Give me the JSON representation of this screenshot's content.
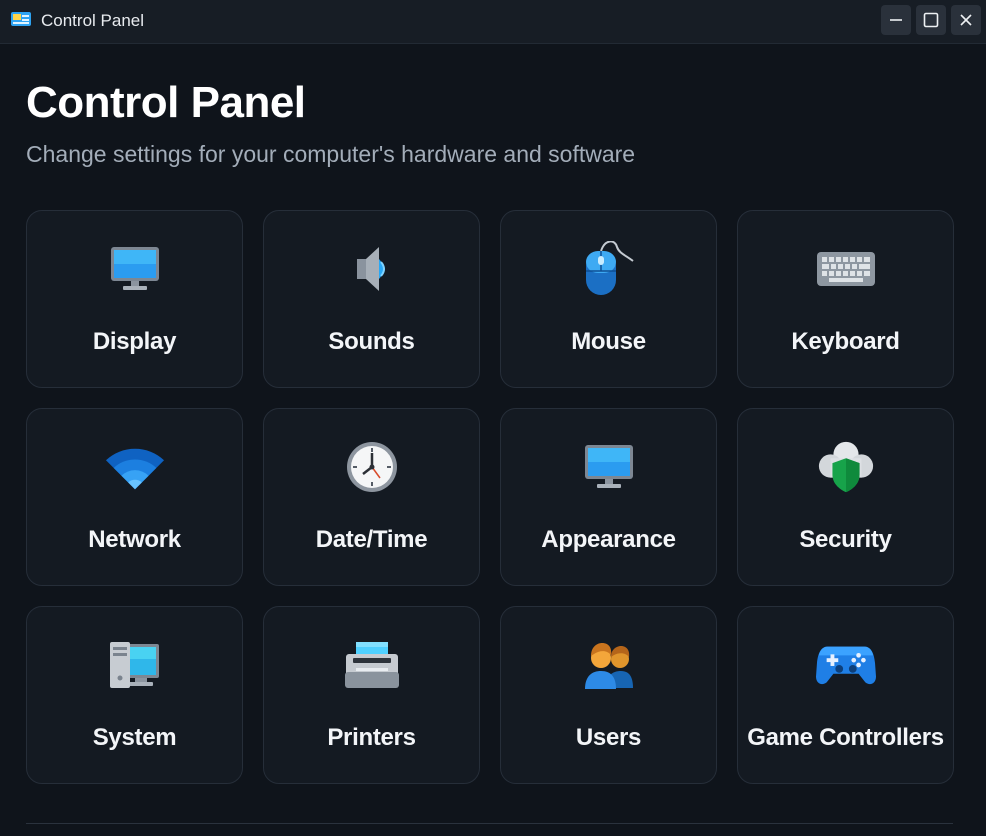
{
  "window": {
    "title": "Control Panel",
    "controls": {
      "minimize": "minimize-icon",
      "maximize": "maximize-icon",
      "close": "close-icon"
    }
  },
  "header": {
    "title": "Control Panel",
    "subtitle": "Change settings for your computer's hardware and software"
  },
  "tiles": [
    {
      "label": "Display",
      "icon": "monitor-icon"
    },
    {
      "label": "Sounds",
      "icon": "speaker-icon"
    },
    {
      "label": "Mouse",
      "icon": "mouse-icon"
    },
    {
      "label": "Keyboard",
      "icon": "keyboard-icon"
    },
    {
      "label": "Network",
      "icon": "wifi-icon"
    },
    {
      "label": "Date/Time",
      "icon": "clock-icon"
    },
    {
      "label": "Appearance",
      "icon": "monitor-icon"
    },
    {
      "label": "Security",
      "icon": "shield-cloud-icon"
    },
    {
      "label": "System",
      "icon": "computer-icon"
    },
    {
      "label": "Printers",
      "icon": "printer-icon"
    },
    {
      "label": "Users",
      "icon": "users-icon"
    },
    {
      "label": "Game Controllers",
      "icon": "gamepad-icon"
    }
  ],
  "colors": {
    "background": "#0f141b",
    "tile": "#141a22",
    "tile_border": "#262e39",
    "subtitle": "#a3adb9",
    "accent_blue": "#1e88e5"
  }
}
